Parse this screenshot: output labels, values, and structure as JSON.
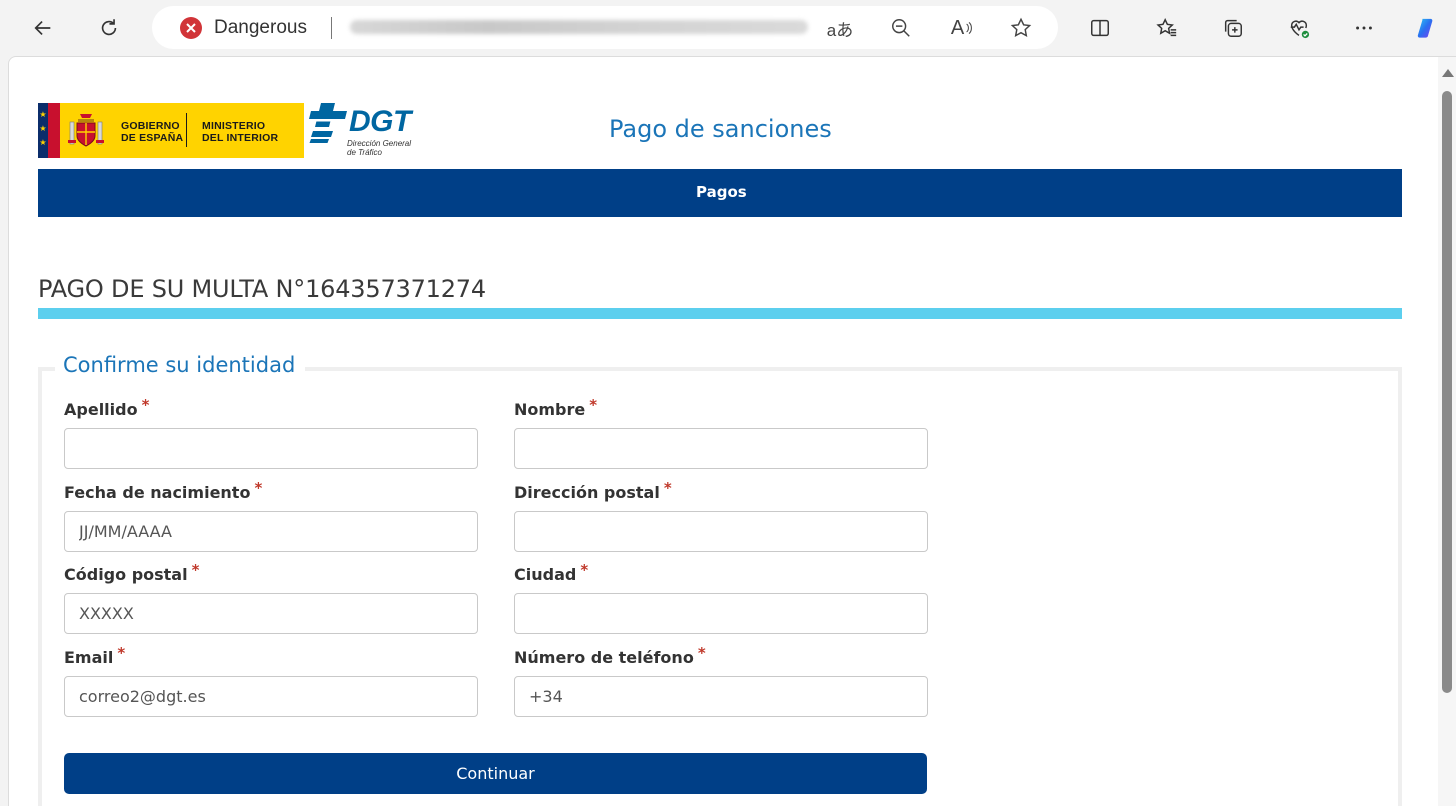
{
  "browser": {
    "security_label": "Dangerous",
    "translate_text": "aあ",
    "read_aloud_text": "A",
    "icons": [
      "back-arrow-icon",
      "refresh-icon",
      "danger-icon",
      "translate-icon",
      "zoom-out-icon",
      "read-aloud-icon",
      "favorite-star-icon",
      "split-screen-icon",
      "favorites-icon",
      "collections-icon",
      "health-icon",
      "more-icon",
      "copilot-icon"
    ]
  },
  "header": {
    "gov_line1": "GOBIERNO",
    "gov_line2": "DE ESPAÑA",
    "min_line1": "MINISTERIO",
    "min_line2": "DEL INTERIOR",
    "dgt_brand": "DGT",
    "dgt_sub1": "Dirección General",
    "dgt_sub2": "de Tráfico",
    "site_title": "Pago de sanciones",
    "nav_label": "Pagos"
  },
  "page": {
    "heading": "PAGO DE SU MULTA N°164357371274"
  },
  "form": {
    "legend": "Confirme su identidad",
    "required_mark": "*",
    "fields": {
      "apellido": {
        "label": "Apellido",
        "placeholder": ""
      },
      "nombre": {
        "label": "Nombre",
        "placeholder": ""
      },
      "fecha": {
        "label": "Fecha de nacimiento",
        "placeholder": "JJ/MM/AAAA"
      },
      "direccion": {
        "label": "Dirección postal",
        "placeholder": ""
      },
      "codigo": {
        "label": "Código postal",
        "placeholder": "XXXXX"
      },
      "ciudad": {
        "label": "Ciudad",
        "placeholder": ""
      },
      "email": {
        "label": "Email",
        "placeholder": "correo2@dgt.es"
      },
      "telefono": {
        "label": "Número de teléfono",
        "placeholder": "+34"
      }
    },
    "submit_label": "Continuar"
  },
  "colors": {
    "nav_blue": "#003f87",
    "title_blue": "#1b75b8",
    "accent_cyan": "#5ccfee",
    "required_red": "#c0392b",
    "danger_red": "#d13438"
  }
}
